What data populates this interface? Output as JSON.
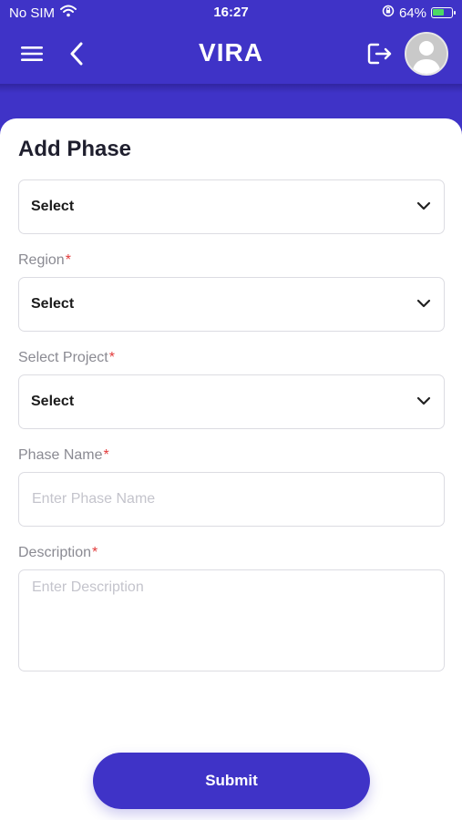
{
  "status_bar": {
    "carrier": "No SIM",
    "time": "16:27",
    "battery": "64%",
    "battery_level": 0.64
  },
  "nav": {
    "title": "VIRA",
    "icons": [
      "menu-icon",
      "back-arrow-icon",
      "logout-icon",
      "avatar"
    ]
  },
  "form": {
    "title": "Add Phase",
    "select_1": {
      "value": "Select"
    },
    "region": {
      "label": "Region",
      "required": "*",
      "value": "Select"
    },
    "project": {
      "label": "Select Project",
      "required": "*",
      "value": "Select"
    },
    "phase_name": {
      "label": "Phase Name",
      "required": "*",
      "placeholder": "Enter Phase Name"
    },
    "description": {
      "label": "Description",
      "required": "*",
      "placeholder": "Enter Description"
    },
    "submit_label": "Submit"
  },
  "colors": {
    "primary": "#3f33c7",
    "required_star": "#e23b3b",
    "label": "#8a8a92",
    "placeholder": "#c4c4cc"
  }
}
